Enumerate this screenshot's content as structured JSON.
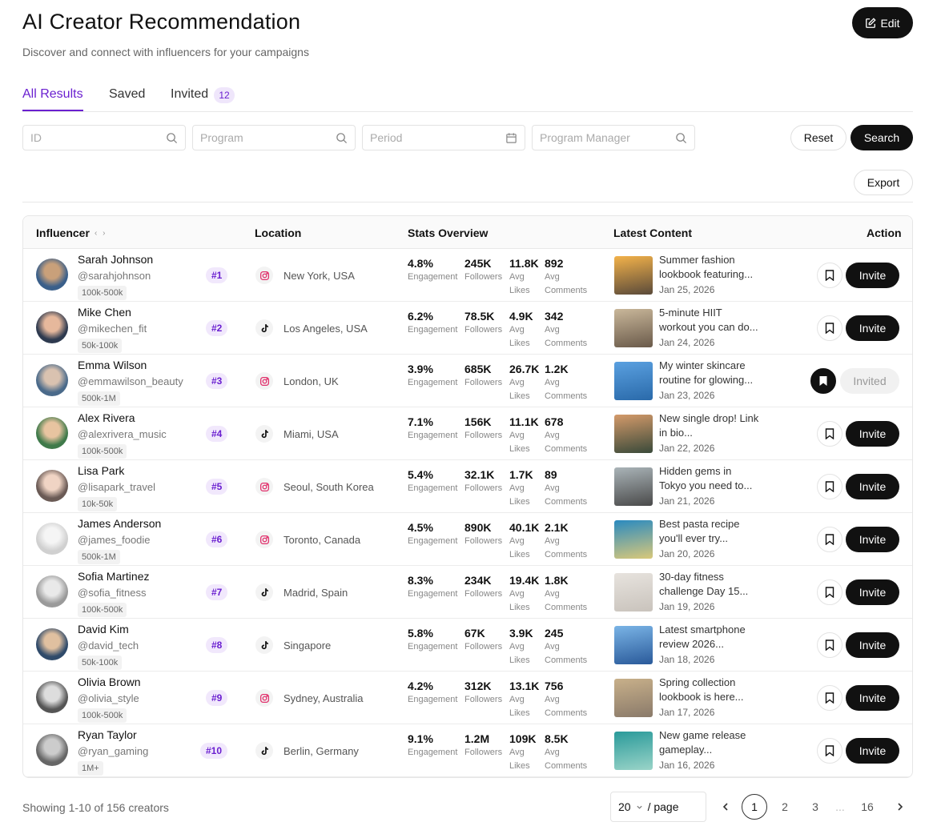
{
  "header": {
    "title": "AI Creator Recommendation",
    "subtitle": "Discover and connect with influencers for your campaigns",
    "edit_label": "Edit"
  },
  "tabs": [
    {
      "label": "All Results",
      "active": true
    },
    {
      "label": "Saved",
      "active": false
    },
    {
      "label": "Invited",
      "active": false,
      "badge": "12"
    }
  ],
  "filters": {
    "id_placeholder": "ID",
    "program_placeholder": "Program",
    "period_placeholder": "Period",
    "manager_placeholder": "Program Manager",
    "reset_label": "Reset",
    "search_label": "Search",
    "export_label": "Export"
  },
  "table": {
    "columns": [
      "Influencer",
      "Location",
      "Stats Overview",
      "Latest Content",
      "Action"
    ],
    "stat_labels": {
      "engagement": "Engagement",
      "followers": "Followers",
      "likes": "Avg Likes",
      "comments": "Avg Comments"
    },
    "invite_label": "Invite",
    "invited_label": "Invited",
    "rows": [
      {
        "name": "Sarah Johnson",
        "handle": "@sarahjohnson",
        "tier": "100k-500k",
        "rank": "#1",
        "platform": "instagram",
        "location": "New York, USA",
        "engagement": "4.8%",
        "followers": "245K",
        "likes": "11.8K",
        "comments": "892",
        "content": "Summer fashion lookbook featuring...",
        "date": "Jan 25, 2026",
        "invited": false
      },
      {
        "name": "Mike Chen",
        "handle": "@mikechen_fit",
        "tier": "50k-100k",
        "rank": "#2",
        "platform": "tiktok",
        "location": "Los Angeles, USA",
        "engagement": "6.2%",
        "followers": "78.5K",
        "likes": "4.9K",
        "comments": "342",
        "content": "5-minute HIIT workout you can do...",
        "date": "Jan 24, 2026",
        "invited": false
      },
      {
        "name": "Emma Wilson",
        "handle": "@emmawilson_beauty",
        "tier": "500k-1M",
        "rank": "#3",
        "platform": "instagram",
        "location": "London, UK",
        "engagement": "3.9%",
        "followers": "685K",
        "likes": "26.7K",
        "comments": "1.2K",
        "content": "My winter skincare routine for glowing...",
        "date": "Jan 23, 2026",
        "invited": true
      },
      {
        "name": "Alex Rivera",
        "handle": "@alexrivera_music",
        "tier": "100k-500k",
        "rank": "#4",
        "platform": "tiktok",
        "location": "Miami, USA",
        "engagement": "7.1%",
        "followers": "156K",
        "likes": "11.1K",
        "comments": "678",
        "content": "New single drop! Link in bio...",
        "date": "Jan 22, 2026",
        "invited": false
      },
      {
        "name": "Lisa Park",
        "handle": "@lisapark_travel",
        "tier": "10k-50k",
        "rank": "#5",
        "platform": "instagram",
        "location": "Seoul, South Korea",
        "engagement": "5.4%",
        "followers": "32.1K",
        "likes": "1.7K",
        "comments": "89",
        "content": "Hidden gems in Tokyo you need to...",
        "date": "Jan 21, 2026",
        "invited": false
      },
      {
        "name": "James Anderson",
        "handle": "@james_foodie",
        "tier": "500k-1M",
        "rank": "#6",
        "platform": "instagram",
        "location": "Toronto, Canada",
        "engagement": "4.5%",
        "followers": "890K",
        "likes": "40.1K",
        "comments": "2.1K",
        "content": "Best pasta recipe you'll ever try...",
        "date": "Jan 20, 2026",
        "invited": false
      },
      {
        "name": "Sofia Martinez",
        "handle": "@sofia_fitness",
        "tier": "100k-500k",
        "rank": "#7",
        "platform": "tiktok",
        "location": "Madrid, Spain",
        "engagement": "8.3%",
        "followers": "234K",
        "likes": "19.4K",
        "comments": "1.8K",
        "content": "30-day fitness challenge Day 15...",
        "date": "Jan 19, 2026",
        "invited": false
      },
      {
        "name": "David Kim",
        "handle": "@david_tech",
        "tier": "50k-100k",
        "rank": "#8",
        "platform": "tiktok",
        "location": "Singapore",
        "engagement": "5.8%",
        "followers": "67K",
        "likes": "3.9K",
        "comments": "245",
        "content": "Latest smartphone review 2026...",
        "date": "Jan 18, 2026",
        "invited": false
      },
      {
        "name": "Olivia Brown",
        "handle": "@olivia_style",
        "tier": "100k-500k",
        "rank": "#9",
        "platform": "instagram",
        "location": "Sydney, Australia",
        "engagement": "4.2%",
        "followers": "312K",
        "likes": "13.1K",
        "comments": "756",
        "content": "Spring collection lookbook is here...",
        "date": "Jan 17, 2026",
        "invited": false
      },
      {
        "name": "Ryan Taylor",
        "handle": "@ryan_gaming",
        "tier": "1M+",
        "rank": "#10",
        "platform": "tiktok",
        "location": "Berlin, Germany",
        "engagement": "9.1%",
        "followers": "1.2M",
        "likes": "109K",
        "comments": "8.5K",
        "content": "New game release gameplay...",
        "date": "Jan 16, 2026",
        "invited": false
      }
    ]
  },
  "footer": {
    "showing": "Showing 1-10 of 156 creators",
    "page_size": "20",
    "page_size_suffix": "/ page",
    "pages": [
      "1",
      "2",
      "3",
      "...",
      "16"
    ],
    "current_page": "1"
  }
}
